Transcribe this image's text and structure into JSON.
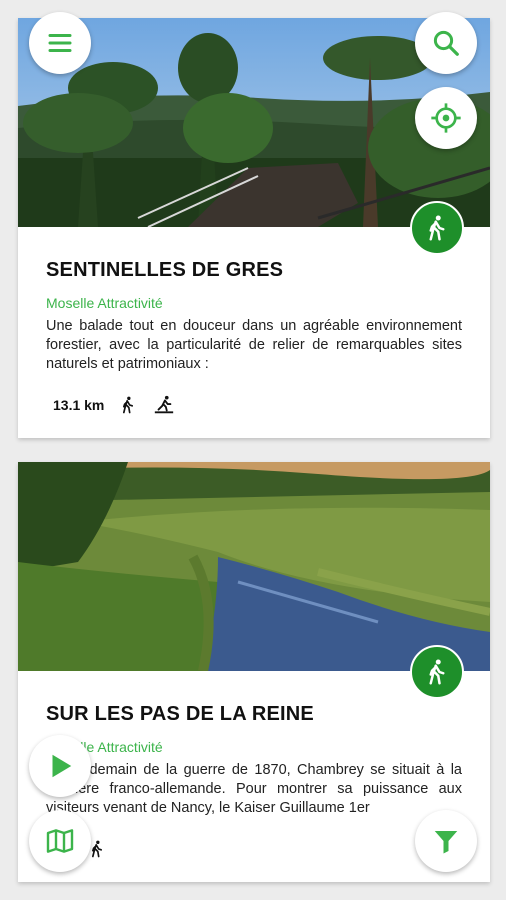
{
  "colors": {
    "accent": "#3cb44b",
    "badge": "#1e8f2a",
    "card": "#ffffff",
    "background": "#ececec"
  },
  "toolbar": {
    "menu_icon": "menu-icon",
    "search_icon": "search-icon",
    "locate_icon": "crosshair-icon"
  },
  "bottom_controls": {
    "play_icon": "play-icon",
    "map_icon": "map-icon",
    "filter_icon": "filter-icon"
  },
  "trails": [
    {
      "title": "SENTINELLES DE GRES",
      "organization": "Moselle Attractivité",
      "description": "Une balade tout en douceur dans un agréable environnement forestier, avec la particularité de relier de remarquables sites naturels et patrimoniaux :",
      "distance": "13.1 km",
      "activity_icon": "hiker-icon",
      "photo": "forest-viewpoint-photo",
      "activities": [
        "hiking-icon",
        "snowshoe-icon"
      ]
    },
    {
      "title": "SUR LES PAS DE LA REINE",
      "organization": "Moselle Attractivité",
      "description": "Au lendemain de la guerre de 1870, Chambrey se situait à la frontière franco-allemande. Pour montrer sa puissance aux visiteurs venant de Nancy, le Kaiser Guillaume 1er",
      "distance": "km",
      "activity_icon": "hiker-icon",
      "photo": "river-meadow-photo",
      "activities": [
        "hiking-icon"
      ]
    }
  ]
}
